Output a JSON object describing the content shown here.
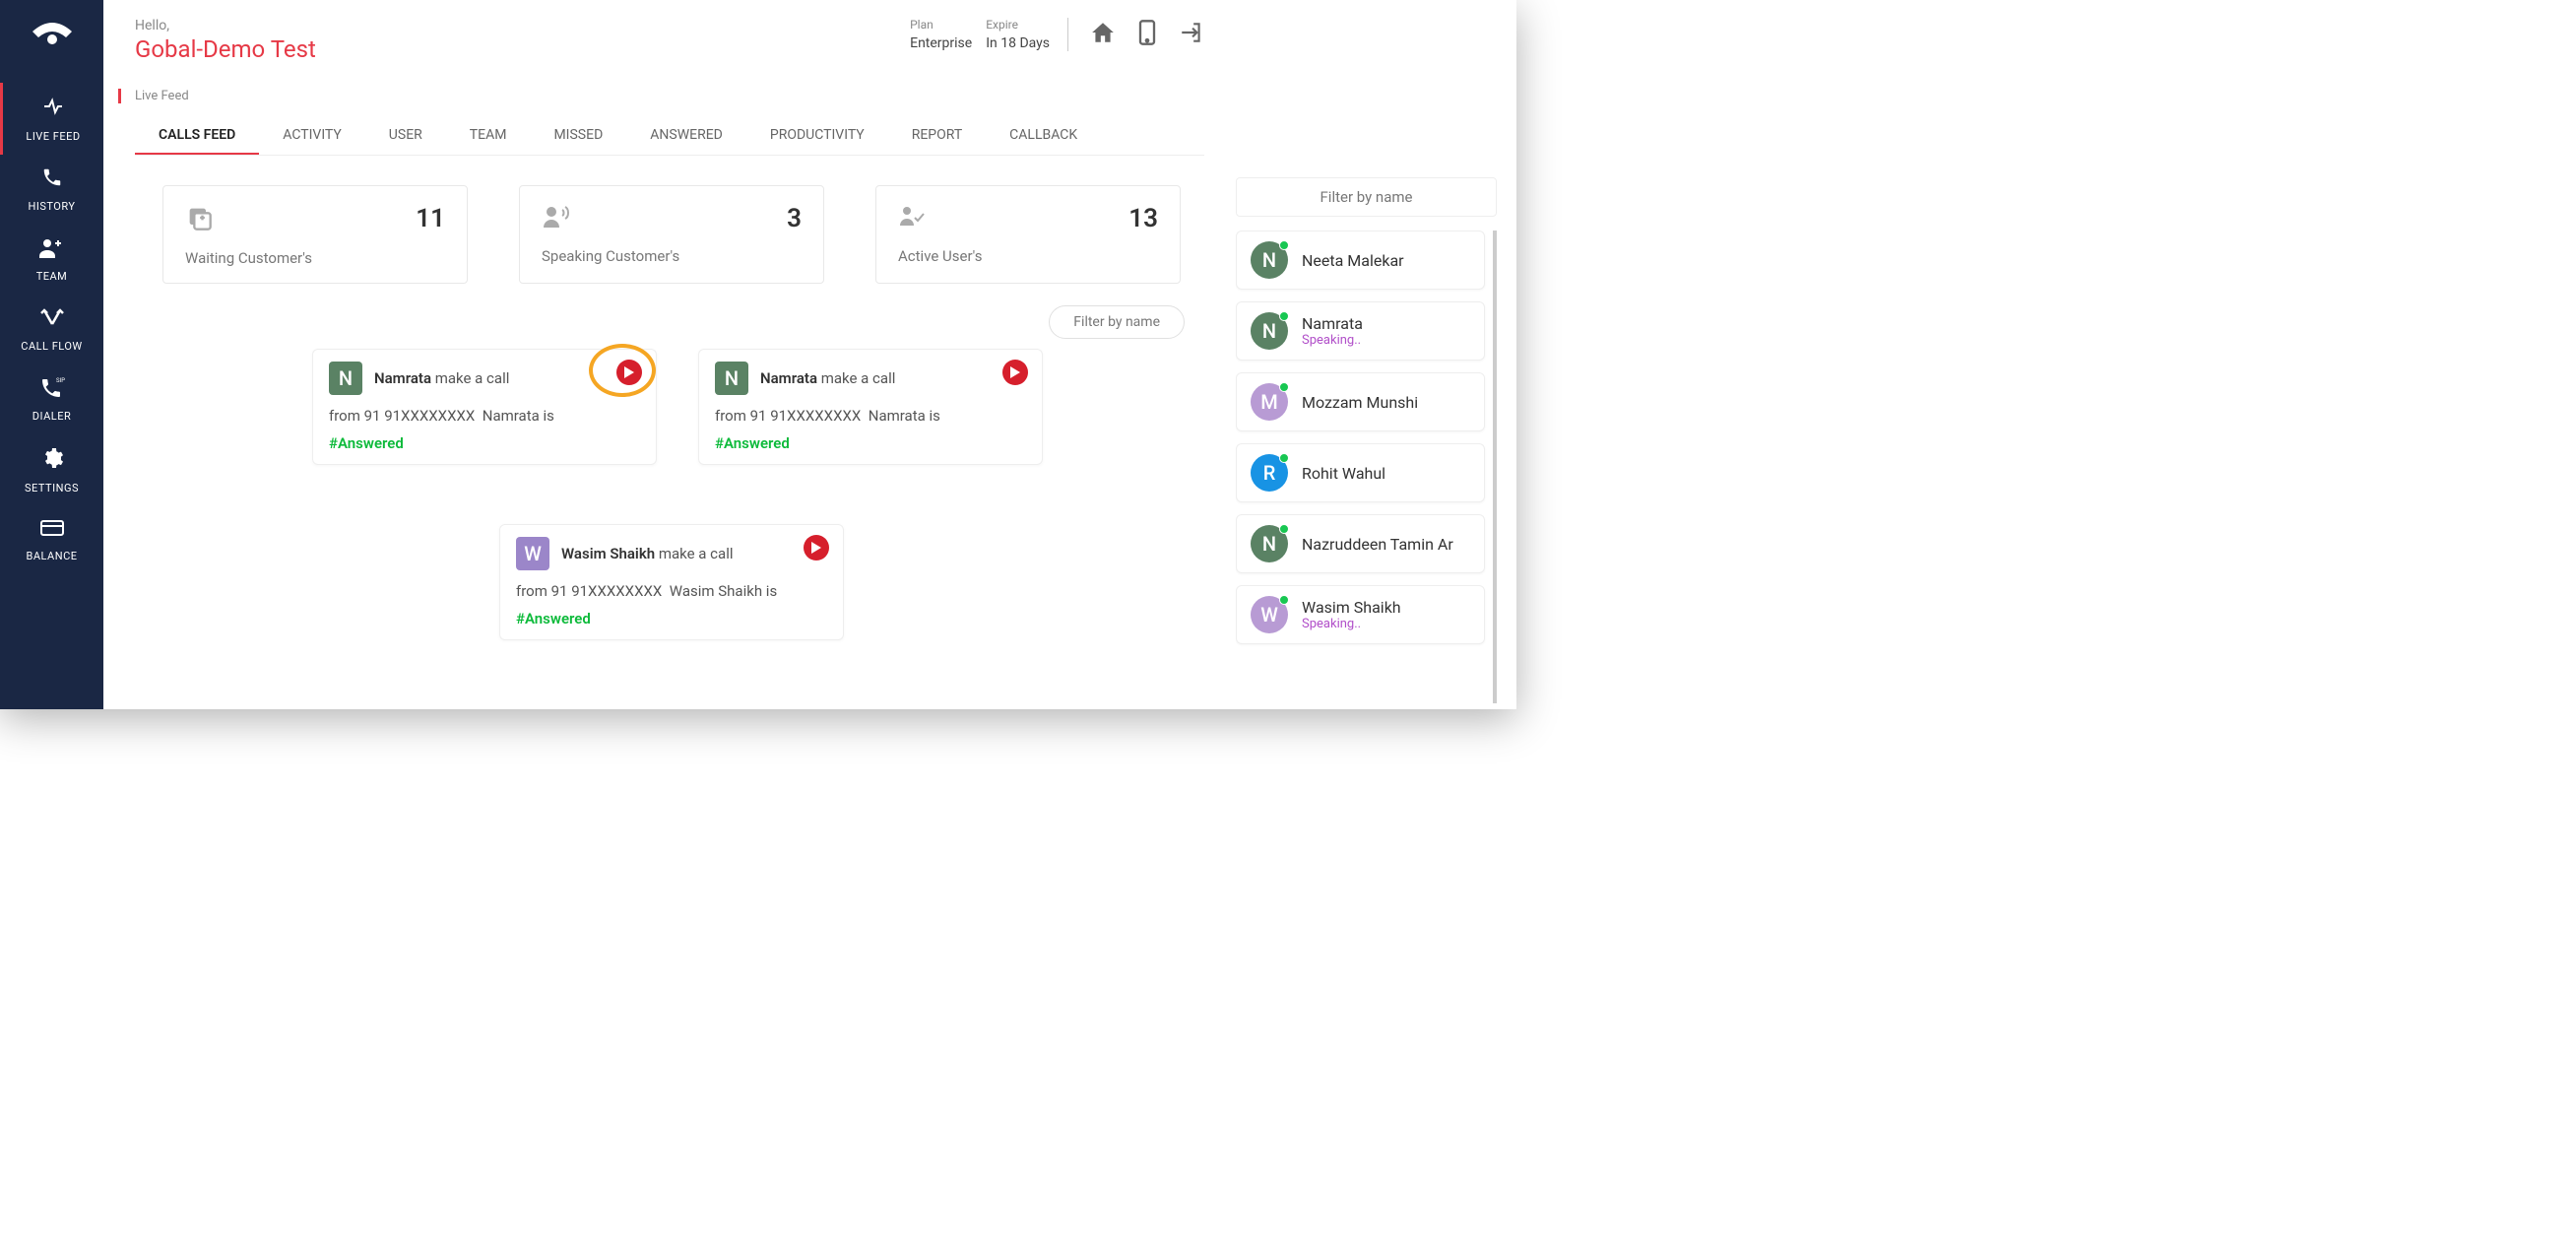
{
  "greeting": {
    "hello": "Hello,",
    "name": "Gobal-Demo Test"
  },
  "plan": {
    "plan_label": "Plan",
    "plan_value": "Enterprise",
    "expire_label": "Expire",
    "expire_value": "In 18 Days"
  },
  "sidebar": {
    "items": [
      {
        "label": "LIVE FEED"
      },
      {
        "label": "HISTORY"
      },
      {
        "label": "TEAM"
      },
      {
        "label": "CALL FLOW"
      },
      {
        "label": "DIALER"
      },
      {
        "label": "SETTINGS"
      },
      {
        "label": "BALANCE"
      }
    ]
  },
  "section_title": "Live Feed",
  "tabs": [
    "CALLS FEED",
    "ACTIVITY",
    "USER",
    "TEAM",
    "MISSED",
    "ANSWERED",
    "PRODUCTIVITY",
    "REPORT",
    "CALLBACK"
  ],
  "stats": [
    {
      "value": "11",
      "label": "Waiting Customer's"
    },
    {
      "value": "3",
      "label": "Speaking Customer's"
    },
    {
      "value": "13",
      "label": "Active User's"
    }
  ],
  "filter_by_name": "Filter by name",
  "feed": [
    {
      "initial": "N",
      "color": "#5a8264",
      "name": "Namrata",
      "action": "make a call",
      "from_label": "from",
      "number": "91 91XXXXXXXX",
      "suffix": "Namrata is",
      "status": "#Answered",
      "highlight": true
    },
    {
      "initial": "N",
      "color": "#5a8264",
      "name": "Namrata",
      "action": "make a call",
      "from_label": "from",
      "number": "91 91XXXXXXXX",
      "suffix": "Namrata is",
      "status": "#Answered",
      "highlight": false
    },
    {
      "initial": "W",
      "color": "#9b86c9",
      "name": "Wasim Shaikh",
      "action": "make a call",
      "from_label": "from",
      "number": "91 91XXXXXXXX",
      "suffix": "Wasim Shaikh is",
      "status": "#Answered",
      "highlight": false
    }
  ],
  "user_filter_label": "Filter by name",
  "users": [
    {
      "initial": "N",
      "color": "#5a8264",
      "name": "Neeta Malekar",
      "status": ""
    },
    {
      "initial": "N",
      "color": "#5a8264",
      "name": "Namrata",
      "status": "Speaking.."
    },
    {
      "initial": "M",
      "color": "#b89bd4",
      "name": "Mozzam Munshi",
      "status": ""
    },
    {
      "initial": "R",
      "color": "#1893e4",
      "name": "Rohit Wahul",
      "status": ""
    },
    {
      "initial": "N",
      "color": "#5a8264",
      "name": "Nazruddeen Tamin Ar",
      "status": ""
    },
    {
      "initial": "W",
      "color": "#b89bd4",
      "name": "Wasim Shaikh",
      "status": "Speaking.."
    }
  ]
}
